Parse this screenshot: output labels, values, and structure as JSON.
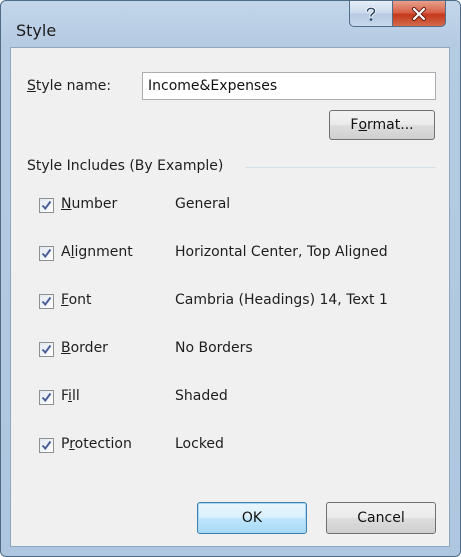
{
  "window": {
    "title": "Style",
    "help_icon": "question-mark-icon",
    "close_icon": "close-x-icon"
  },
  "style_name": {
    "label_accel": "S",
    "label_rest": "tyle name:",
    "value": "Income&Expenses"
  },
  "format_button": {
    "before": "F",
    "accel": "o",
    "after": "rmat..."
  },
  "group": {
    "title": "Style Includes (By Example)"
  },
  "rows": [
    {
      "pre": "",
      "accel": "N",
      "post": "umber",
      "value": "General",
      "checked": true
    },
    {
      "pre": "A",
      "accel": "l",
      "post": "ignment",
      "value": "Horizontal Center, Top Aligned",
      "checked": true
    },
    {
      "pre": "",
      "accel": "F",
      "post": "ont",
      "value": "Cambria (Headings) 14, Text 1",
      "checked": true
    },
    {
      "pre": "",
      "accel": "B",
      "post": "order",
      "value": "No Borders",
      "checked": true
    },
    {
      "pre": "F",
      "accel": "i",
      "post": "ll",
      "value": "Shaded",
      "checked": true
    },
    {
      "pre": "P",
      "accel": "r",
      "post": "otection",
      "value": "Locked",
      "checked": true
    }
  ],
  "buttons": {
    "ok": "OK",
    "cancel": "Cancel"
  },
  "colors": {
    "title_bar": "#b5cbe2",
    "close_button": "#c4381b",
    "checkmark": "#4a5f97"
  }
}
